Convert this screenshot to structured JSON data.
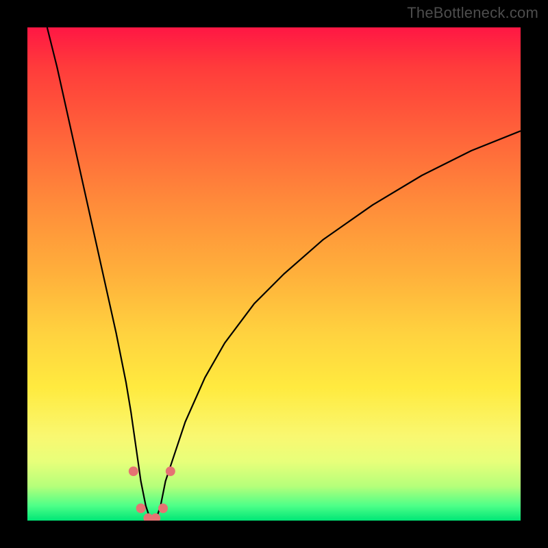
{
  "watermark": "TheBottleneck.com",
  "chart_data": {
    "type": "line",
    "title": "",
    "xlabel": "",
    "ylabel": "",
    "xlim": [
      0,
      100
    ],
    "ylim": [
      0,
      100
    ],
    "grid": false,
    "legend": false,
    "series": [
      {
        "name": "curve",
        "x": [
          4,
          6,
          8,
          10,
          12,
          14,
          16,
          18,
          20,
          21,
          22,
          23,
          24,
          25,
          26,
          27,
          28,
          30,
          32,
          36,
          40,
          46,
          52,
          60,
          70,
          80,
          90,
          100
        ],
        "y": [
          100,
          92,
          83,
          74,
          65,
          56,
          47,
          38,
          28,
          22,
          15,
          8,
          3,
          0,
          0,
          3,
          8,
          14,
          20,
          29,
          36,
          44,
          50,
          57,
          64,
          70,
          75,
          79
        ]
      }
    ],
    "markers": [
      {
        "x": 21.5,
        "y": 10
      },
      {
        "x": 23.0,
        "y": 2.5
      },
      {
        "x": 24.5,
        "y": 0.5
      },
      {
        "x": 26.0,
        "y": 0.5
      },
      {
        "x": 27.5,
        "y": 2.5
      },
      {
        "x": 29.0,
        "y": 10
      }
    ],
    "background_gradient": {
      "top": "#ff1744",
      "middle": "#ffd23f",
      "bottom": "#00e676"
    }
  }
}
